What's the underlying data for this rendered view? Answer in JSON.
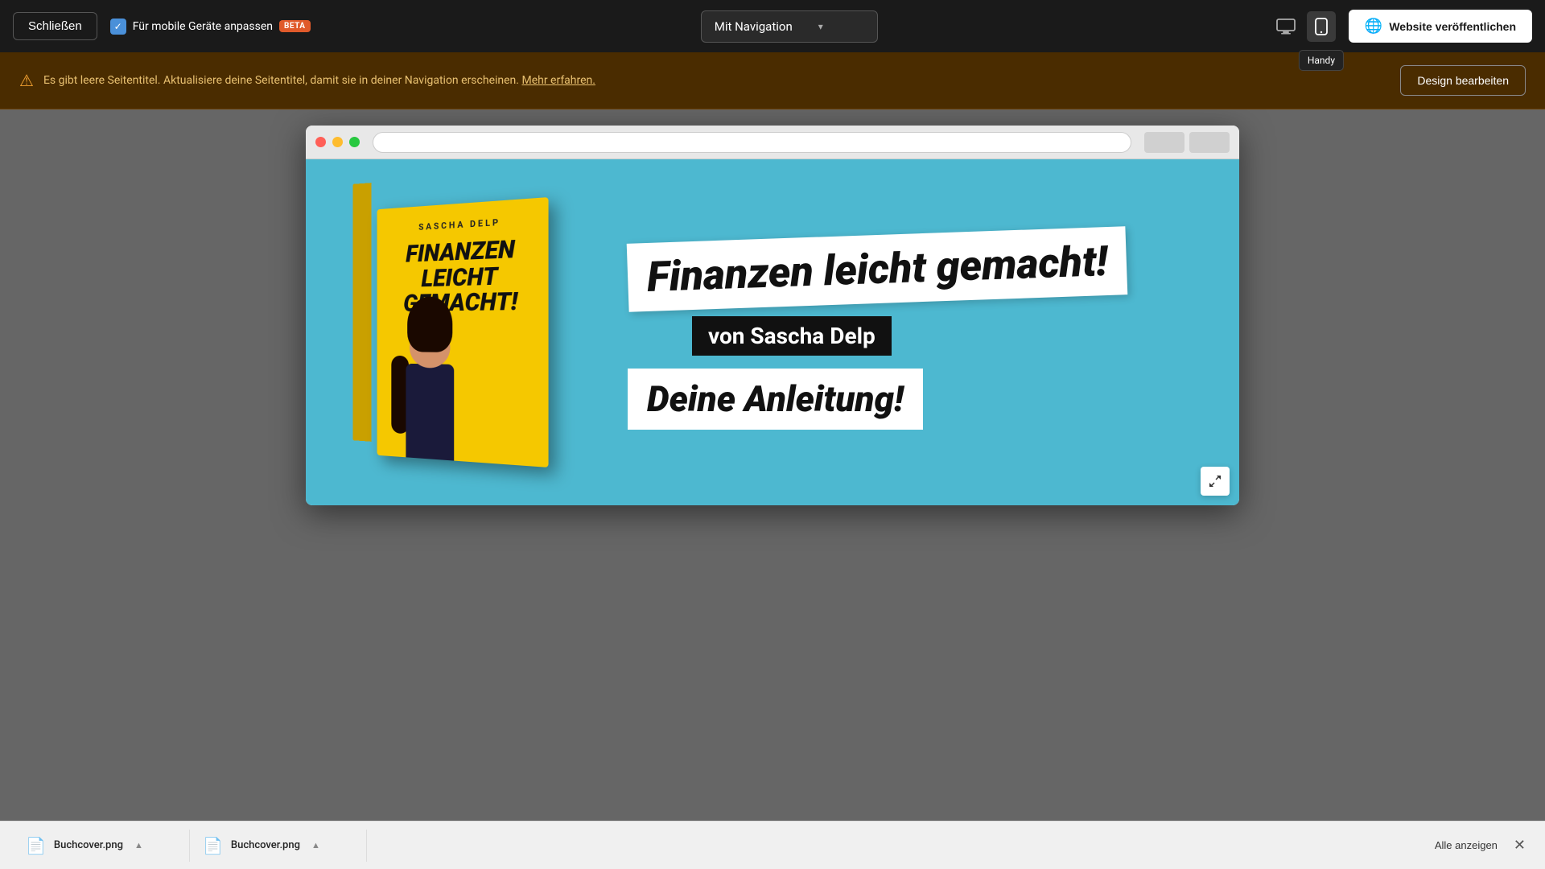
{
  "background": {
    "color": "#f5c800"
  },
  "toolbar": {
    "close_label": "Schließen",
    "mobile_toggle_label": "Für mobile Geräte anpassen",
    "beta_label": "BETA",
    "nav_dropdown_label": "Mit Navigation",
    "device_desktop_tooltip": "Desktop",
    "device_handy_tooltip": "Handy",
    "publish_label": "Website veröffentlichen"
  },
  "alert": {
    "text": "Es gibt leere Seitentitel. Aktualisiere deine Seitentitel, damit sie in deiner Navigation erscheinen.",
    "link_text": "Mehr erfahren.",
    "action_label": "Design bearbeiten"
  },
  "hero": {
    "book_author": "SASCHA DELP",
    "book_title": "FINANZEN\nLEICHT\nGEMACHT!",
    "main_title": "Finanzen leicht gemacht!",
    "subtitle_dark": "von Sascha Delp",
    "subtitle_white": "Deine Anleitung!"
  },
  "downloads": [
    {
      "filename": "Buchcover.png",
      "icon": "📄"
    },
    {
      "filename": "Buchcover.png",
      "icon": "📄"
    }
  ],
  "download_bar": {
    "show_all_label": "Alle anzeigen"
  }
}
